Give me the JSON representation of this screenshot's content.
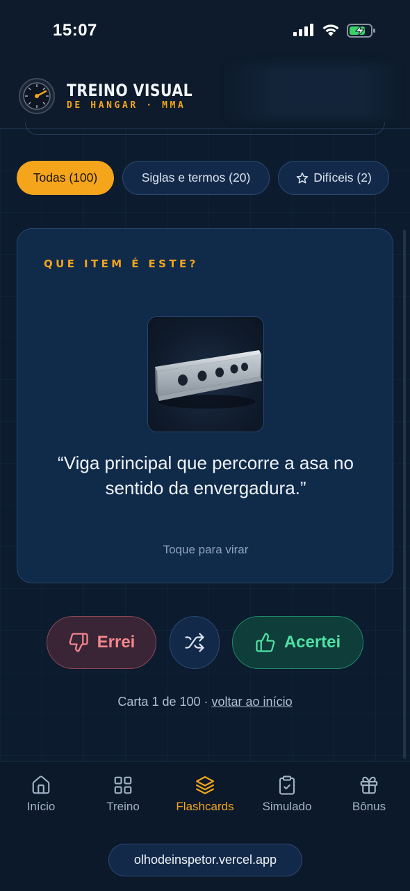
{
  "status_bar": {
    "time": "15:07"
  },
  "header": {
    "title": "TREINO VISUAL",
    "subtitle": "DE HANGAR · MMA",
    "logo_icon": "gauge-logo-icon"
  },
  "filters": [
    {
      "label": "Todas (100)",
      "selected": true
    },
    {
      "label": "Siglas e termos (20)",
      "selected": false
    },
    {
      "label": "Difíceis (2)",
      "selected": false,
      "icon": "star-icon"
    }
  ],
  "card": {
    "prompt": "QUE ITEM É ESTE?",
    "image_icon": "wing-spar-image",
    "text": "“Viga principal que percorre a asa no sentido da envergadura.”",
    "hint": "Toque para virar"
  },
  "actions": {
    "wrong_label": "Errei",
    "wrong_icon": "thumbs-down-icon",
    "shuffle_icon": "shuffle-icon",
    "right_label": "Acertei",
    "right_icon": "thumbs-up-icon"
  },
  "progress": {
    "text": "Carta 1 de 100 · ",
    "link": "voltar ao início"
  },
  "nav": [
    {
      "label": "Início",
      "icon": "home-icon",
      "active": false
    },
    {
      "label": "Treino",
      "icon": "grid-icon",
      "active": false
    },
    {
      "label": "Flashcards",
      "icon": "layers-icon",
      "active": true
    },
    {
      "label": "Simulado",
      "icon": "clipboard-check-icon",
      "active": false
    },
    {
      "label": "Bônus",
      "icon": "gift-icon",
      "active": false
    }
  ],
  "browser": {
    "url": "olhodeinspetor.vercel.app"
  },
  "colors": {
    "accent": "#f4a51c",
    "background": "#0c1a2c",
    "card": "#102a4a",
    "wrong": "#f4878f",
    "right": "#4ee2a4"
  }
}
